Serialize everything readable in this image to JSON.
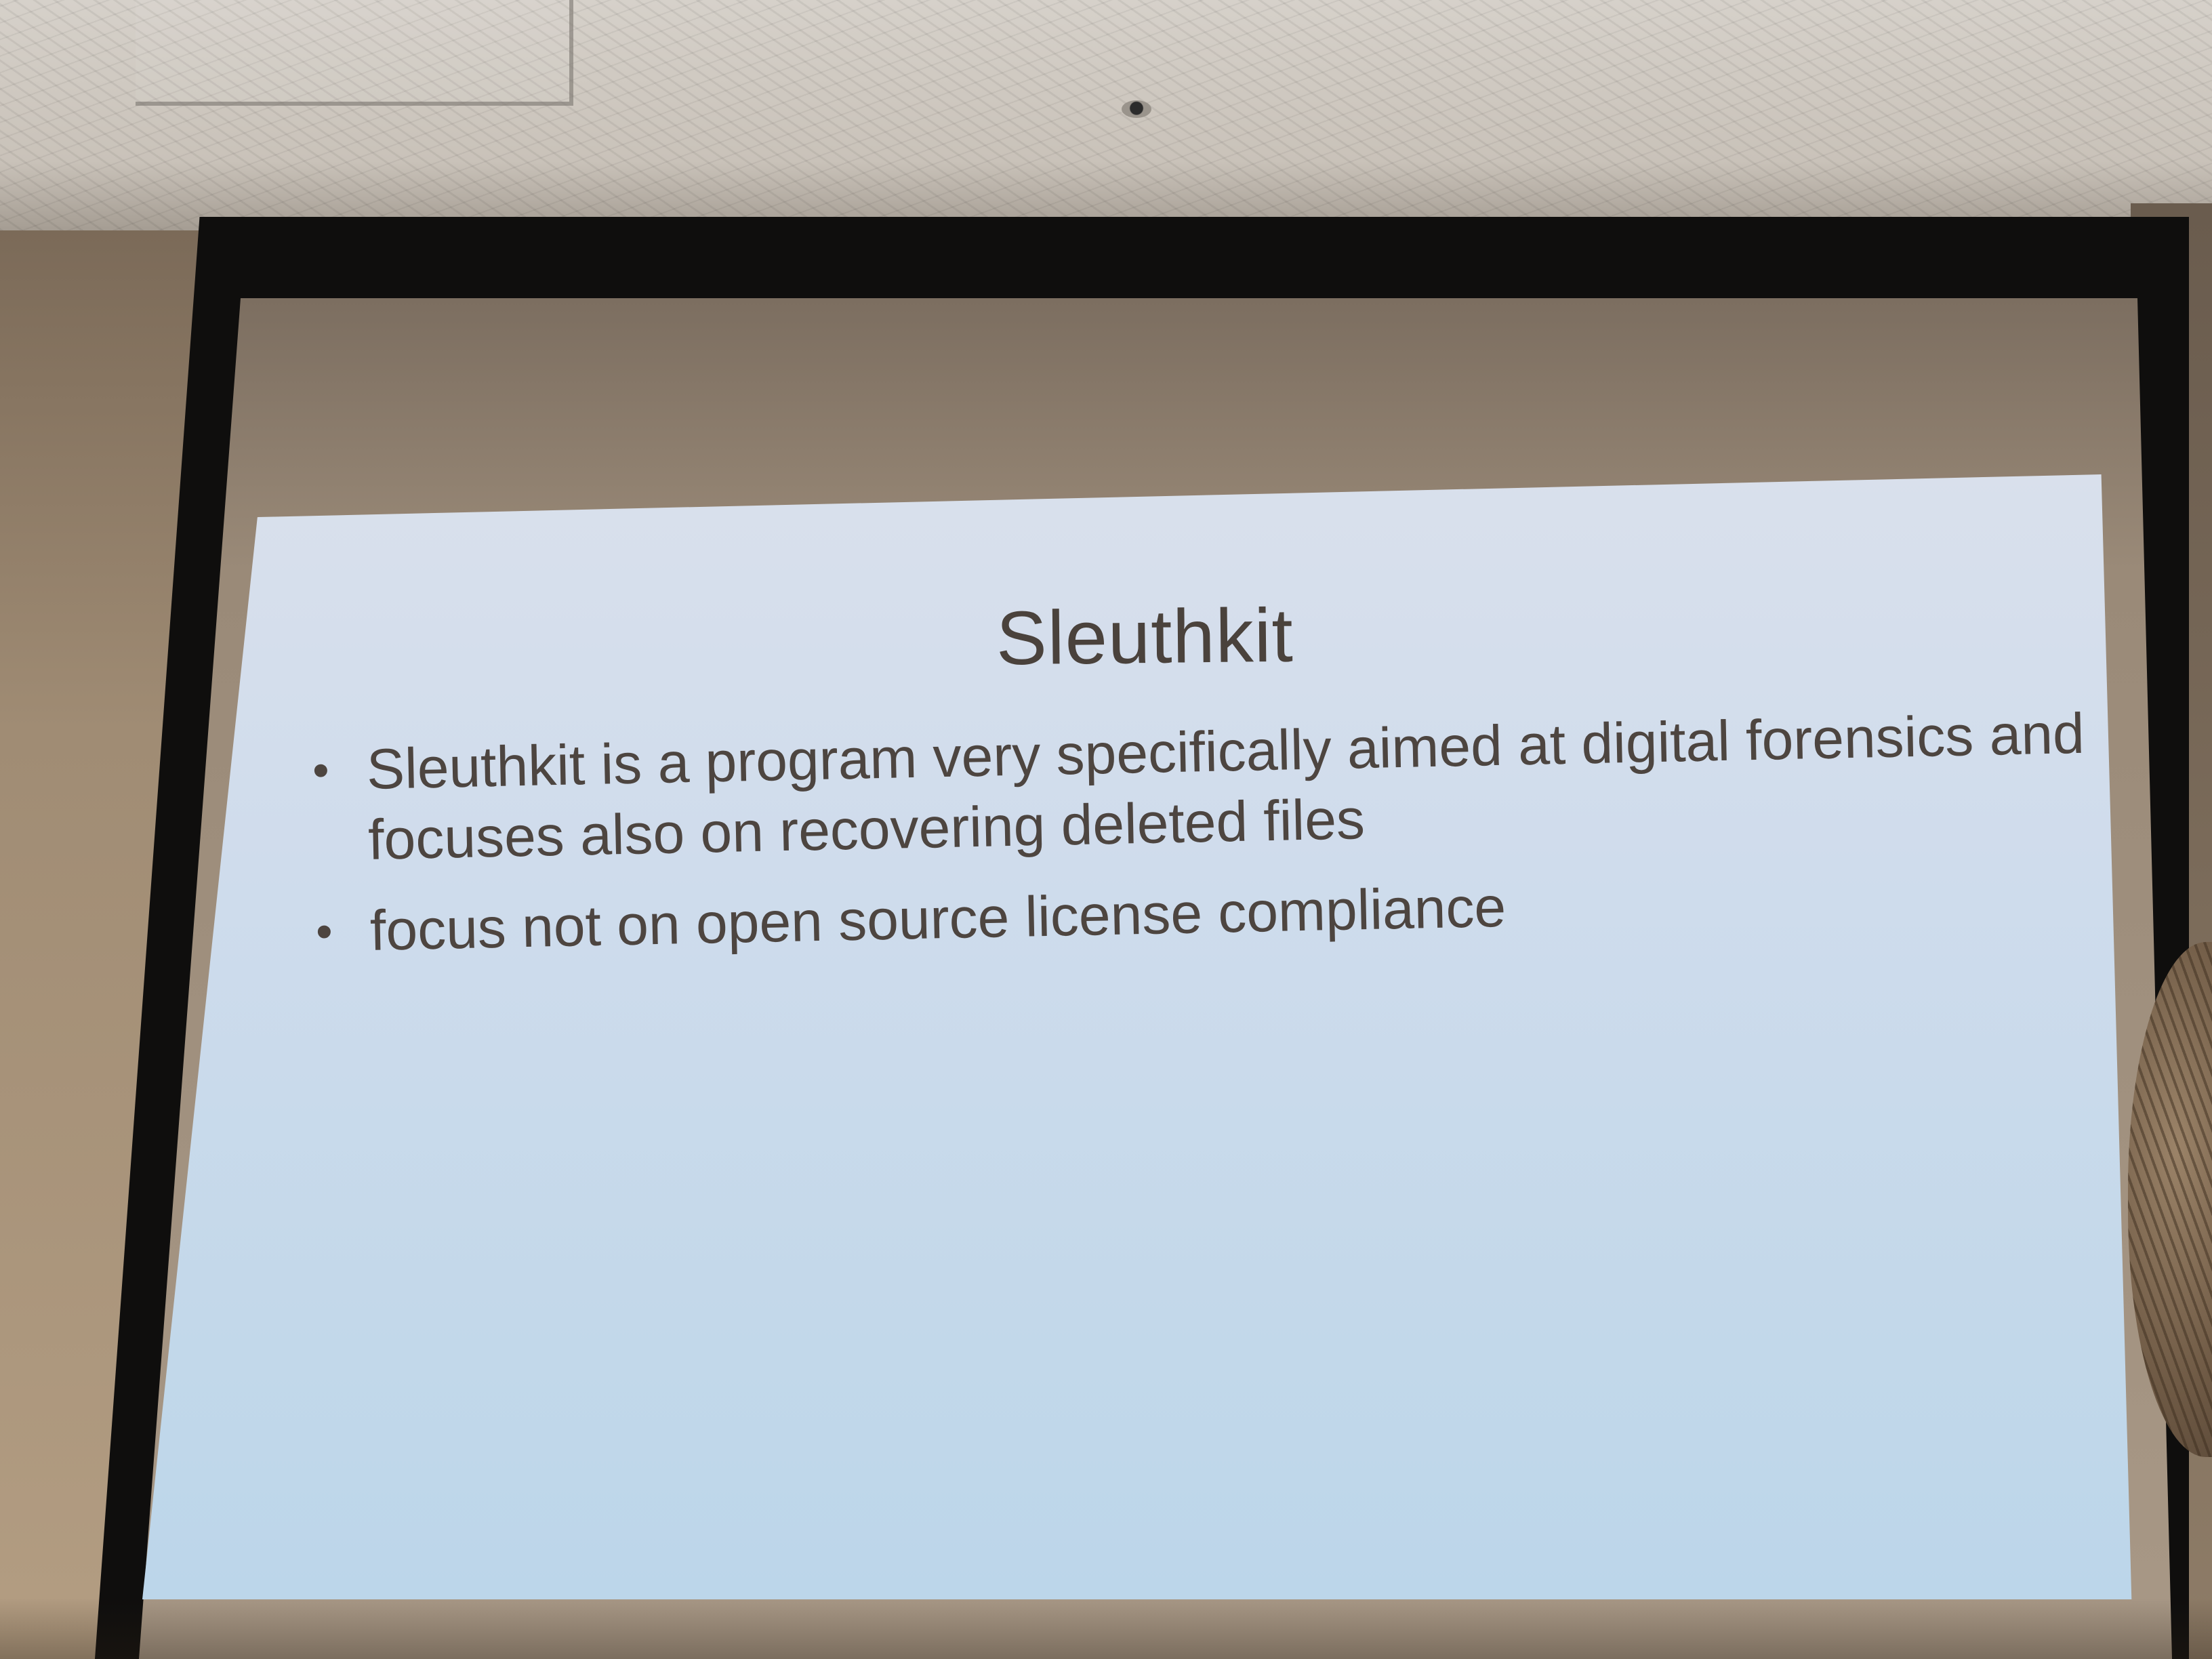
{
  "slide": {
    "title": "Sleuthkit",
    "bullets": [
      "Sleuthkit is a program very specifically aimed at digital forensics and focuses also on recovering deleted files",
      "focus not on open source license compliance"
    ]
  },
  "colors": {
    "slide_background": "#c9dbec",
    "slide_text": "#4d4540",
    "screen_frame": "#0f0e0d",
    "ceiling": "#d0cac2"
  }
}
